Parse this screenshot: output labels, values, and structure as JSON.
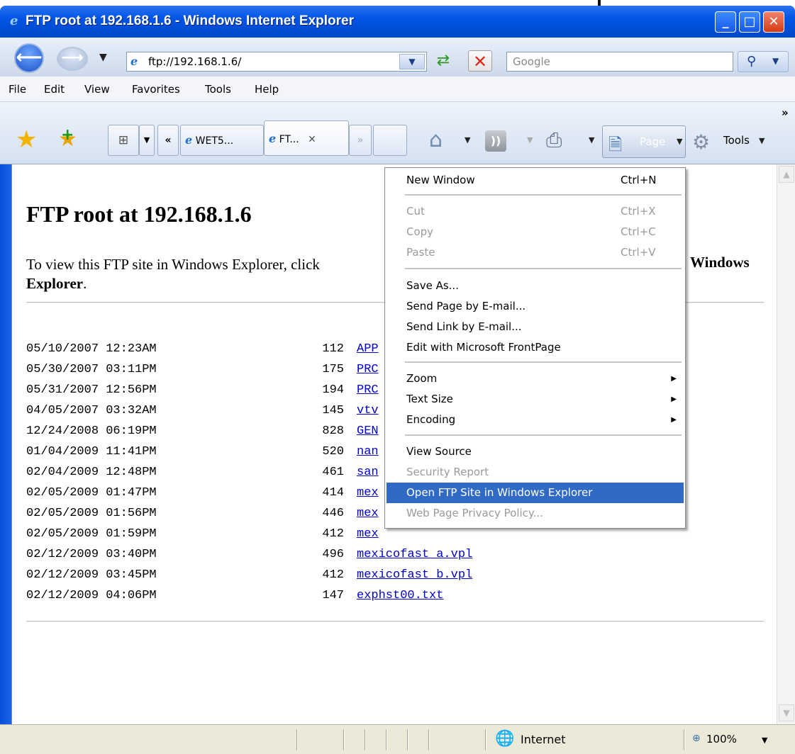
{
  "window": {
    "title": "FTP root at 192.168.1.6 - Windows Internet Explorer",
    "min_label": "_",
    "max_label": "□",
    "close_label": "✕"
  },
  "nav": {
    "address": "ftp://192.168.1.6/",
    "search_placeholder": "Google"
  },
  "menubar": [
    "File",
    "Edit",
    "View",
    "Favorites",
    "Tools",
    "Help"
  ],
  "tabs": [
    {
      "label": "WET5...",
      "active": false
    },
    {
      "label": "FT...",
      "active": true
    }
  ],
  "toolbar": {
    "page_label": "Page",
    "tools_label": "Tools"
  },
  "content": {
    "heading": "FTP root at 192.168.1.6",
    "intro_left": "To view this FTP site in Windows Explorer, click",
    "intro_right": "Windows",
    "intro_line2_bold": "Explorer",
    "intro_line2_end": ".",
    "listing": [
      {
        "date": "05/10/2007 12:23AM",
        "size": "112",
        "name": "APP"
      },
      {
        "date": "05/30/2007 03:11PM",
        "size": "175",
        "name": "PRC"
      },
      {
        "date": "05/31/2007 12:56PM",
        "size": "194",
        "name": "PRC"
      },
      {
        "date": "04/05/2007 03:32AM",
        "size": "145",
        "name": "vtv"
      },
      {
        "date": "12/24/2008 06:19PM",
        "size": "828",
        "name": "GEN"
      },
      {
        "date": "01/04/2009 11:41PM",
        "size": "520",
        "name": "nan"
      },
      {
        "date": "02/04/2009 12:48PM",
        "size": "461",
        "name": "san"
      },
      {
        "date": "02/05/2009 01:47PM",
        "size": "414",
        "name": "mex"
      },
      {
        "date": "02/05/2009 01:56PM",
        "size": "446",
        "name": "mex"
      },
      {
        "date": "02/05/2009 01:59PM",
        "size": "412",
        "name": "mex"
      },
      {
        "date": "02/12/2009 03:40PM",
        "size": "496",
        "name": "mexicofast a.vpl"
      },
      {
        "date": "02/12/2009 03:45PM",
        "size": "412",
        "name": "mexicofast b.vpl"
      },
      {
        "date": "02/12/2009 04:06PM",
        "size": "147",
        "name": "exphst00.txt"
      }
    ]
  },
  "page_menu": {
    "items": [
      {
        "label": "New Window",
        "shortcut": "Ctrl+N",
        "disabled": false
      },
      {
        "label": "Cut",
        "shortcut": "Ctrl+X",
        "disabled": true
      },
      {
        "label": "Copy",
        "shortcut": "Ctrl+C",
        "disabled": true
      },
      {
        "label": "Paste",
        "shortcut": "Ctrl+V",
        "disabled": true
      },
      {
        "label": "Save As...",
        "shortcut": "",
        "disabled": false
      },
      {
        "label": "Send Page by E-mail...",
        "shortcut": "",
        "disabled": false
      },
      {
        "label": "Send Link by E-mail...",
        "shortcut": "",
        "disabled": false
      },
      {
        "label": "Edit with Microsoft FrontPage",
        "shortcut": "",
        "disabled": false
      },
      {
        "label": "Zoom",
        "submenu": true,
        "disabled": false
      },
      {
        "label": "Text Size",
        "submenu": true,
        "disabled": false
      },
      {
        "label": "Encoding",
        "submenu": true,
        "disabled": false
      },
      {
        "label": "View Source",
        "shortcut": "",
        "disabled": false
      },
      {
        "label": "Security Report",
        "shortcut": "",
        "disabled": true
      },
      {
        "label": "Open FTP Site in Windows Explorer",
        "shortcut": "",
        "disabled": false,
        "highlighted": true
      },
      {
        "label": "Web Page Privacy Policy...",
        "shortcut": "",
        "disabled": true
      }
    ]
  },
  "status": {
    "zone": "Internet",
    "zoom": "100%"
  },
  "icons": {
    "back": "back-arrow-icon",
    "forward": "forward-arrow-icon",
    "refresh": "refresh-icon",
    "stop": "stop-icon",
    "search": "magnifier-icon",
    "favorites": "favorites-star-icon",
    "add_favorites": "add-favorites-icon",
    "home": "home-icon",
    "feeds": "rss-feed-icon",
    "print": "printer-icon",
    "page": "page-icon",
    "tools": "gear-icon",
    "zone": "globe-icon",
    "zoom": "magnifier-zoom-icon"
  },
  "colors": {
    "titlebar": "#0055e5",
    "menu_highlight": "#316ac5",
    "link": "#0000cc"
  }
}
